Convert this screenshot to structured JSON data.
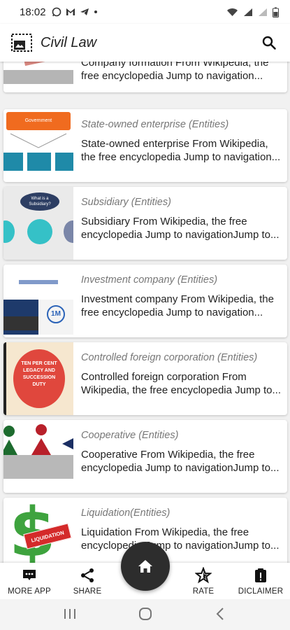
{
  "status_bar": {
    "time": "18:02",
    "notification_icons": [
      "whatsapp-icon",
      "gmail-icon",
      "telegram-icon",
      "dot-icon"
    ],
    "system_icons": [
      "wifi-icon",
      "signal-icon",
      "signal-icon",
      "battery-icon"
    ]
  },
  "app_bar": {
    "title": "Civil Law",
    "logo_icon": "image-frame-icon",
    "search_icon": "search-icon"
  },
  "items": [
    {
      "title": "",
      "description": "Company formation From Wikipedia, the free encyclopedia Jump to navigation...",
      "thumb": "company-formation"
    },
    {
      "title": "State-owned enterprise (Entities)",
      "description": "State-owned enterprise From Wikipedia, the free encyclopedia Jump to navigation...",
      "thumb": "government-chart",
      "thumb_label": "Government"
    },
    {
      "title": "Subsidiary (Entities)",
      "description": "Subsidiary From Wikipedia, the free encyclopedia Jump to navigationJump to...",
      "thumb": "subsidiary-diagram",
      "thumb_label": "What is a Subsidiary?"
    },
    {
      "title": "Investment company (Entities)",
      "description": "Investment company From Wikipedia, the free encyclopedia Jump to navigation...",
      "thumb": "investment-logo",
      "thumb_label": "1M"
    },
    {
      "title": "Controlled foreign corporation (Entities)",
      "description": "Controlled foreign corporation From Wikipedia, the free encyclopedia Jump to...",
      "thumb": "ten-per-cent-stamp",
      "thumb_label": "TEN PER CENT LEGACY AND SUCCESSION DUTY"
    },
    {
      "title": "Cooperative (Entities)",
      "description": "Cooperative From Wikipedia, the free encyclopedia Jump to navigationJump to...",
      "thumb": "cooperative-figures"
    },
    {
      "title": "Liquidation(Entities)",
      "description": "Liquidation From Wikipedia, the free encyclopedia Jump to navigationJump to...",
      "thumb": "liquidation-dollar",
      "thumb_label": "LIQUIDATION"
    }
  ],
  "bottom_nav": {
    "more_apps": "MORE APP",
    "share": "SHARE",
    "rate": "RATE",
    "disclaimer": "DICLAIMER"
  },
  "fab_icon": "home-icon",
  "system_nav": [
    "recents-icon",
    "home-circle-icon",
    "back-icon"
  ]
}
